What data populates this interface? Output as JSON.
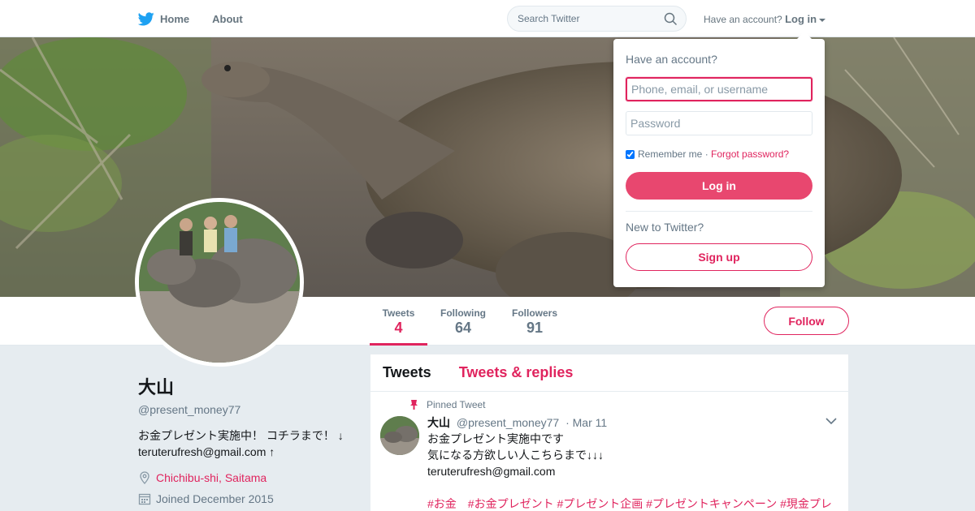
{
  "colors": {
    "accent": "#e0245e",
    "login_button": "#e8476f",
    "brand_blue": "#1da1f2"
  },
  "nav": {
    "home_label": "Home",
    "about_label": "About",
    "search_placeholder": "Search Twitter",
    "account_prompt": "Have an account?",
    "login_label": "Log in"
  },
  "profile_nav": {
    "stats": [
      {
        "label": "Tweets",
        "value": "4"
      },
      {
        "label": "Following",
        "value": "64"
      },
      {
        "label": "Followers",
        "value": "91"
      }
    ],
    "follow_label": "Follow"
  },
  "profile": {
    "name": "大山",
    "handle": "@present_money77",
    "bio_line1": "お金プレゼント実施中！ コチラまで！ ↓",
    "bio_line2": "teruterufresh@gmail.com ↑",
    "location": "Chichibu-shi, Saitama",
    "joined": "Joined December 2015"
  },
  "timeline": {
    "tabs": [
      "Tweets",
      "Tweets & replies"
    ],
    "pinned_label": "Pinned Tweet",
    "tweet": {
      "name": "大山",
      "handle": "@present_money77",
      "date": "· Mar 11",
      "line1": "お金プレゼント実施中です",
      "line2": "気になる方欲しい人こちらまで↓↓↓",
      "line3": "teruterufresh@gmail.com",
      "tags": "#お金　#お金プレゼント #プレゼント企画 #プレゼントキャンペーン #現金プレ"
    }
  },
  "login_dropdown": {
    "title": "Have an account?",
    "username_placeholder": "Phone, email, or username",
    "password_placeholder": "Password",
    "remember_label": "Remember me ·",
    "forgot_label": "Forgot password?",
    "login_button": "Log in",
    "new_prompt": "New to Twitter?",
    "signup_button": "Sign up"
  }
}
